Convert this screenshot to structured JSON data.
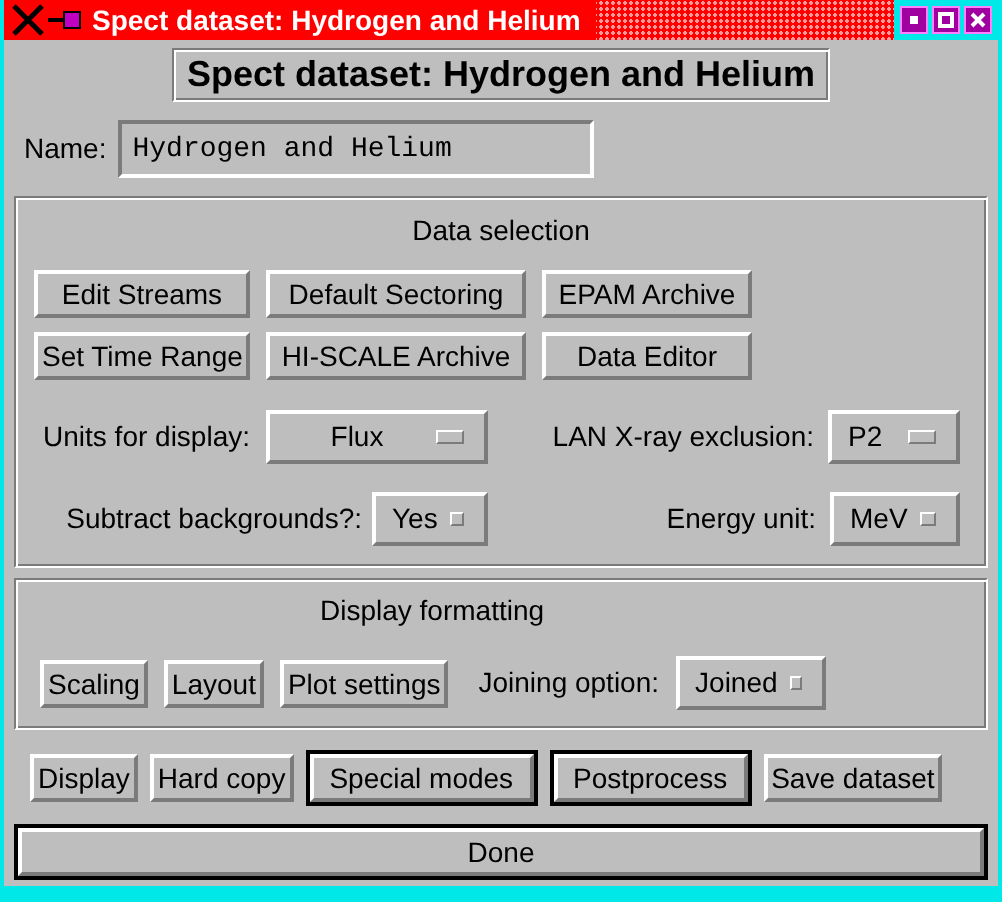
{
  "window": {
    "title": "Spect dataset: Hydrogen and Helium"
  },
  "heading": "Spect dataset: Hydrogen and Helium",
  "name_field": {
    "label": "Name:",
    "value": "Hydrogen and Helium"
  },
  "data_selection": {
    "title": "Data selection",
    "buttons": [
      {
        "label": "Edit Streams"
      },
      {
        "label": "Default Sectoring"
      },
      {
        "label": "EPAM Archive"
      },
      {
        "label": "Set Time Range"
      },
      {
        "label": "HI-SCALE Archive"
      },
      {
        "label": "Data Editor"
      }
    ],
    "options": [
      {
        "label": "Units for display:",
        "value": "Flux"
      },
      {
        "label": "LAN X-ray exclusion:",
        "value": "P2"
      },
      {
        "label": "Subtract backgrounds?:",
        "value": "Yes"
      },
      {
        "label": "Energy unit:",
        "value": "MeV"
      }
    ]
  },
  "display_formatting": {
    "title": "Display formatting",
    "buttons": [
      {
        "label": "Scaling"
      },
      {
        "label": "Layout"
      },
      {
        "label": "Plot settings"
      }
    ],
    "options": [
      {
        "label": "Joining option:",
        "value": "Joined"
      }
    ]
  },
  "actions": [
    {
      "label": "Display",
      "default": false
    },
    {
      "label": "Hard copy",
      "default": false
    },
    {
      "label": "Special modes",
      "default": true
    },
    {
      "label": "Postprocess",
      "default": true
    },
    {
      "label": "Save dataset",
      "default": false
    }
  ],
  "done_button": {
    "label": "Done",
    "default": true
  }
}
